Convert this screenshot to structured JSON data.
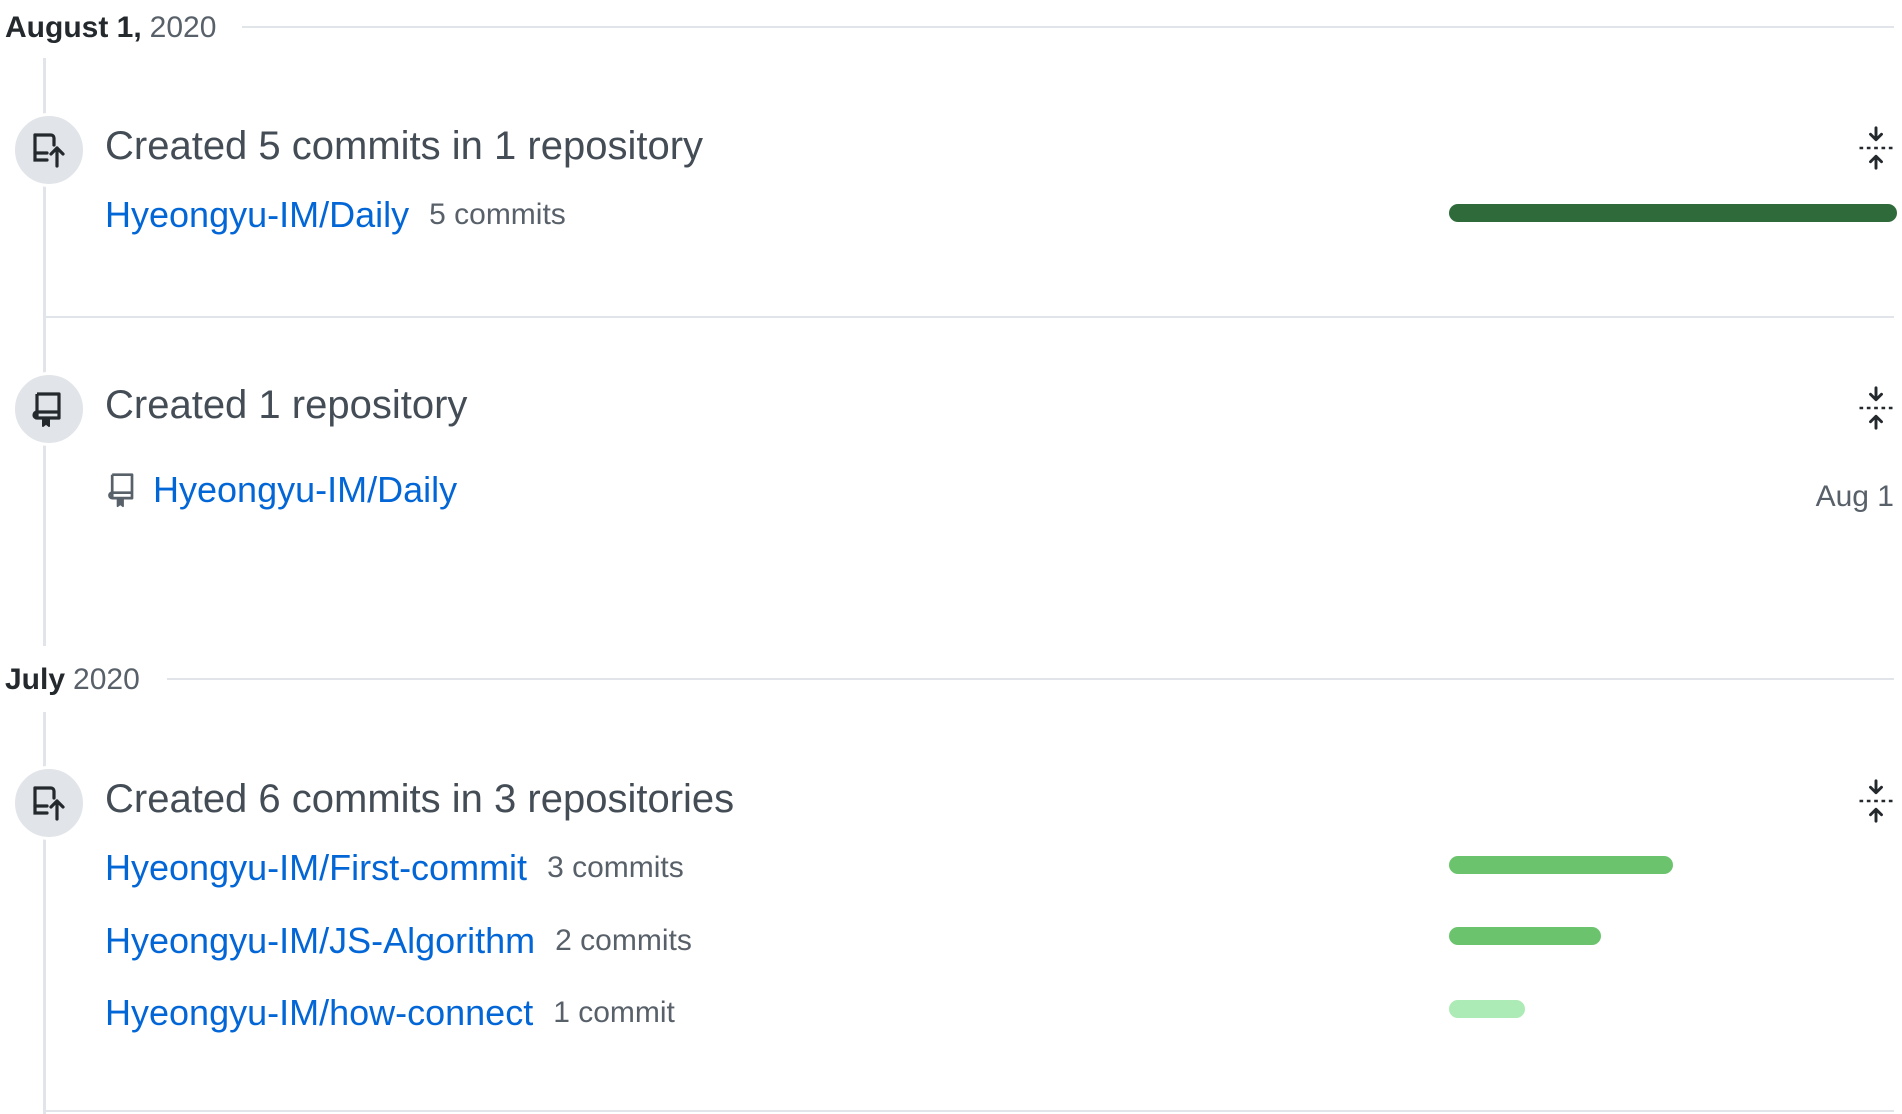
{
  "sections": [
    {
      "month": "August 1,",
      "year": "2020",
      "items": [
        {
          "type": "commits",
          "title": "Created 5 commits in 1 repository",
          "icon": "repo-push-icon",
          "repos": [
            {
              "name": "Hyeongyu-IM/Daily",
              "count": "5 commits",
              "bar_fraction": 1.0,
              "bar_color": "#2f6b3a"
            }
          ]
        },
        {
          "type": "repo-created",
          "title": "Created 1 repository",
          "icon": "repo-icon",
          "repo": {
            "name": "Hyeongyu-IM/Daily",
            "date": "Aug 1"
          }
        }
      ]
    },
    {
      "month": "July",
      "year": "2020",
      "items": [
        {
          "type": "commits",
          "title": "Created 6 commits in 3 repositories",
          "icon": "repo-push-icon",
          "repos": [
            {
              "name": "Hyeongyu-IM/First-commit",
              "count": "3 commits",
              "bar_fraction": 0.5,
              "bar_color": "#6bc46d"
            },
            {
              "name": "Hyeongyu-IM/JS-Algorithm",
              "count": "2 commits",
              "bar_fraction": 0.34,
              "bar_color": "#6bc46d"
            },
            {
              "name": "Hyeongyu-IM/how-connect",
              "count": "1 commit",
              "bar_fraction": 0.17,
              "bar_color": "#acebb5"
            }
          ]
        }
      ]
    }
  ]
}
